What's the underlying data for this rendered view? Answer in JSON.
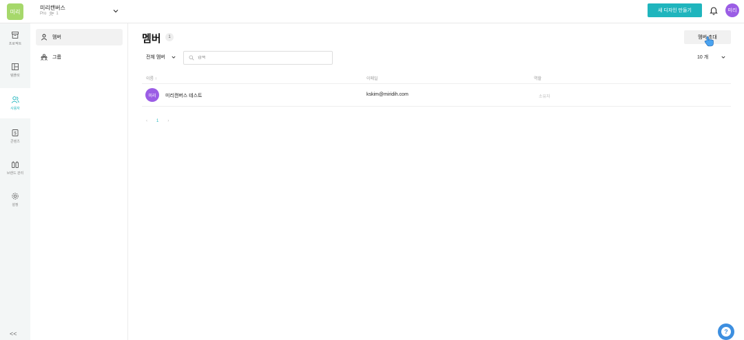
{
  "workspace": {
    "logo_text": "미리",
    "name": "미리캔버스",
    "plan": "Pro",
    "member_count": "1"
  },
  "header": {
    "new_design_label": "새 디자인 만들기",
    "avatar_text": "미리"
  },
  "rail": {
    "items": [
      {
        "label": "프로젝트",
        "icon": "archive-icon"
      },
      {
        "label": "템플릿",
        "icon": "layout-icon"
      },
      {
        "label": "사용자",
        "icon": "users-icon",
        "active": true
      },
      {
        "label": "콘텐츠",
        "icon": "content-icon"
      },
      {
        "label": "브랜드 관리",
        "icon": "brand-icon"
      },
      {
        "label": "설정",
        "icon": "gear-icon"
      }
    ],
    "collapse_label": "<<"
  },
  "submenu": {
    "items": [
      {
        "label": "멤버",
        "icon": "person-icon",
        "active": true
      },
      {
        "label": "그룹",
        "icon": "group-icon"
      }
    ]
  },
  "main": {
    "title": "멤버",
    "count": "1",
    "invite_label": "멤버 초대",
    "filter_label": "전체 멤버",
    "search_placeholder": "검색",
    "page_size_label": "10 개",
    "columns": {
      "name": "이름 ↑",
      "email": "이메일",
      "role": "역할"
    },
    "rows": [
      {
        "avatar": "미리",
        "name": "미리캔버스 테스트",
        "email": "kskim@miridih.com",
        "role": "소유자"
      }
    ],
    "pagination": {
      "prev": "‹",
      "current": "1",
      "next": "›"
    }
  },
  "colors": {
    "accent": "#1fb5bd",
    "avatar": "#9b5de5",
    "logo": "#a6d86b",
    "help": "#3d8fe0"
  },
  "help_label": "?"
}
